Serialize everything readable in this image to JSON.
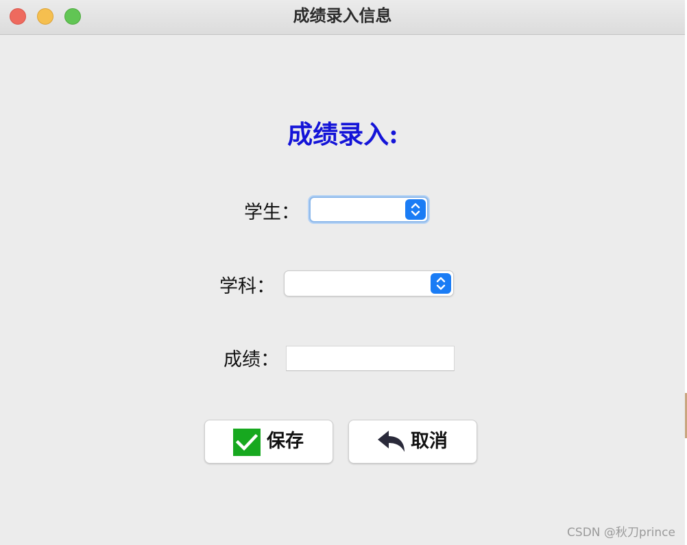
{
  "window": {
    "title": "成绩录入信息"
  },
  "form": {
    "heading": "成绩录入:",
    "student_label": "学生：",
    "student_value": "",
    "subject_label": "学科：",
    "subject_value": "",
    "score_label": "成绩：",
    "score_value": ""
  },
  "buttons": {
    "save_label": "保存",
    "cancel_label": "取消"
  },
  "icons": {
    "save": "check-icon",
    "cancel": "undo-arrow-icon",
    "dropdown": "up-down-chevron-icon"
  },
  "colors": {
    "heading": "#1414d8",
    "accent": "#1a7cf5",
    "check_green": "#17a81f",
    "close": "#ee6a5e",
    "minimize": "#f5bf4f",
    "maximize": "#61c554"
  },
  "watermark": "CSDN @秋刀prince"
}
